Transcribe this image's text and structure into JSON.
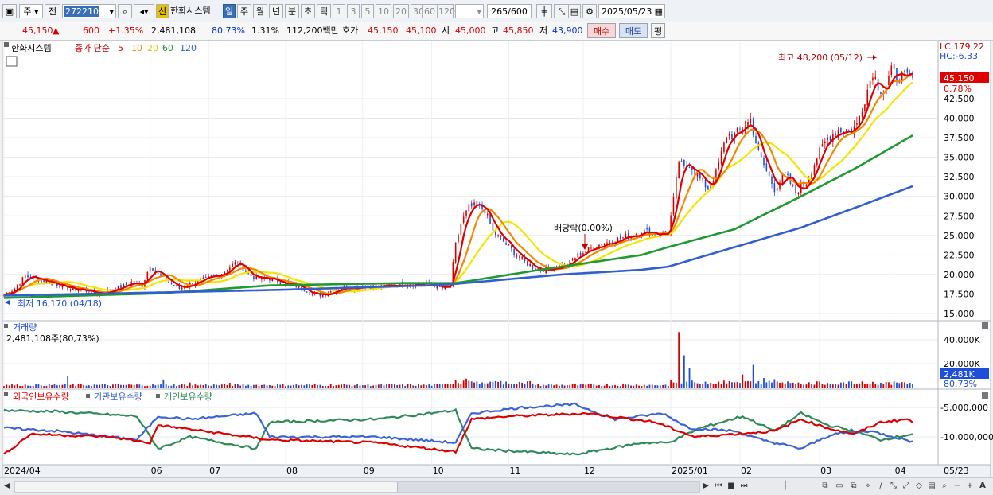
{
  "toolbar": {
    "market": "주",
    "prev_label": "전",
    "code": "272210",
    "new_badge": "신",
    "stock_name": "한화시스템",
    "periods": [
      "일",
      "주",
      "월",
      "년",
      "분",
      "초",
      "틱"
    ],
    "active_period": "일",
    "intervals": [
      "1",
      "3",
      "5",
      "10",
      "20",
      "30",
      "60",
      "120"
    ],
    "count": "265",
    "count_total": "/600",
    "date": "2025/05/23"
  },
  "info": {
    "price": "45,150",
    "arrow": "▲",
    "change": "600",
    "change_pct": "+1.35%",
    "volume": "2,481,108",
    "vol_ratio": "80.73%",
    "turnover": "1.31%",
    "amount": "112,200백만",
    "quote_label": "호가",
    "ask": "45,150",
    "bid": "45,100",
    "open_label": "시",
    "open": "45,000",
    "high_label": "고",
    "high": "45,850",
    "low_label": "저",
    "low": "43,900",
    "buy_label": "매수",
    "sell_label": "매도",
    "eval_label": "평"
  },
  "colors": {
    "up": "#d40000",
    "down": "#1f4fd8",
    "ma5": "#e00000",
    "ma10": "#f08a00",
    "ma20": "#f5e400",
    "ma60": "#1f9a2e",
    "ma120": "#2f5fd0",
    "foreign": "#e00000",
    "institution": "#3a63d6",
    "individual": "#2e8b57"
  },
  "chart_data": [
    {
      "type": "candlestick",
      "panel": "price",
      "stock": "한화시스템",
      "legend": {
        "title": "한화시스템",
        "series_label": "종가 단순",
        "ma_periods": [
          "5",
          "10",
          "20",
          "60",
          "120"
        ]
      },
      "right_top": {
        "lc": "LC:179.22",
        "hc": "HC:-6.33"
      },
      "y_ticks": [
        "42,500",
        "40,000",
        "37,500",
        "35,000",
        "32,500",
        "30,000",
        "27,500",
        "25,000",
        "22,500",
        "20,000",
        "17,500",
        "15,000"
      ],
      "y_tick_values": [
        42500,
        40000,
        37500,
        35000,
        32500,
        30000,
        27500,
        25000,
        22500,
        20000,
        17500,
        15000
      ],
      "ylim": [
        14000,
        49500
      ],
      "current_price": "45,150",
      "current_price_value": 45150,
      "current_pct": "0.78%",
      "max_label": "최고 48,200 (05/12)",
      "max_value": 48200,
      "min_label": "최저 16,170 (04/18)",
      "min_value": 16170,
      "event_label": "배당락(0.00%)",
      "x_months": [
        "2024/04",
        "06",
        "07",
        "08",
        "09",
        "10",
        "11",
        "12",
        "2025/01",
        "02",
        "03",
        "04",
        "05",
        "05/23"
      ],
      "close_anchors": [
        [
          0,
          17400
        ],
        [
          4,
          18200
        ],
        [
          8,
          19800
        ],
        [
          12,
          19500
        ],
        [
          18,
          19000
        ],
        [
          24,
          18200
        ],
        [
          30,
          18000
        ],
        [
          36,
          17500
        ],
        [
          40,
          18000
        ],
        [
          44,
          18400
        ],
        [
          48,
          19000
        ],
        [
          52,
          18600
        ],
        [
          55,
          21200
        ],
        [
          58,
          20000
        ],
        [
          62,
          19000
        ],
        [
          66,
          18200
        ],
        [
          70,
          18800
        ],
        [
          74,
          19200
        ],
        [
          78,
          19600
        ],
        [
          82,
          20200
        ],
        [
          86,
          21200
        ],
        [
          88,
          21600
        ],
        [
          92,
          20000
        ],
        [
          96,
          19400
        ],
        [
          100,
          19500
        ],
        [
          104,
          19000
        ],
        [
          108,
          18600
        ],
        [
          112,
          18400
        ],
        [
          116,
          17500
        ],
        [
          120,
          17400
        ],
        [
          124,
          18000
        ],
        [
          128,
          18400
        ],
        [
          132,
          18400
        ],
        [
          136,
          18600
        ],
        [
          140,
          18400
        ],
        [
          146,
          18600
        ],
        [
          152,
          18800
        ],
        [
          158,
          18900
        ],
        [
          162,
          18600
        ],
        [
          166,
          18000
        ],
        [
          168,
          18700
        ],
        [
          170,
          23800
        ],
        [
          172,
          26500
        ],
        [
          175,
          28600
        ],
        [
          178,
          28800
        ],
        [
          181,
          28200
        ],
        [
          184,
          25500
        ],
        [
          188,
          24200
        ],
        [
          192,
          22800
        ],
        [
          196,
          21600
        ],
        [
          200,
          20800
        ],
        [
          204,
          20600
        ],
        [
          208,
          21000
        ],
        [
          212,
          21200
        ],
        [
          216,
          22500
        ],
        [
          220,
          23200
        ],
        [
          224,
          23800
        ],
        [
          228,
          24200
        ],
        [
          232,
          24600
        ],
        [
          236,
          25000
        ],
        [
          240,
          25600
        ],
        [
          244,
          25300
        ],
        [
          248,
          25200
        ],
        [
          250,
          25400
        ],
        [
          252,
          29500
        ],
        [
          254,
          34500
        ],
        [
          256,
          33500
        ],
        [
          258,
          34200
        ],
        [
          262,
          32200
        ],
        [
          265,
          31000
        ],
        [
          268,
          33000
        ],
        [
          272,
          37800
        ],
        [
          275,
          37800
        ],
        [
          278,
          38800
        ],
        [
          281,
          39800
        ],
        [
          284,
          35500
        ],
        [
          287,
          33200
        ],
        [
          290,
          31000
        ],
        [
          294,
          32800
        ],
        [
          298,
          30500
        ],
        [
          302,
          31800
        ],
        [
          306,
          35000
        ],
        [
          310,
          37500
        ],
        [
          314,
          38500
        ],
        [
          318,
          38300
        ],
        [
          321,
          39200
        ],
        [
          324,
          42500
        ],
        [
          327,
          46000
        ],
        [
          329,
          44200
        ],
        [
          331,
          43300
        ],
        [
          334,
          46000
        ],
        [
          336,
          45400
        ],
        [
          339,
          45300
        ],
        [
          342,
          45150
        ]
      ],
      "ma_series": {
        "ma60": [
          [
            0,
            17000
          ],
          [
            60,
            17600
          ],
          [
            100,
            18600
          ],
          [
            150,
            18900
          ],
          [
            170,
            18900
          ],
          [
            200,
            20500
          ],
          [
            240,
            22500
          ],
          [
            250,
            23500
          ],
          [
            275,
            25800
          ],
          [
            300,
            30000
          ],
          [
            320,
            33500
          ],
          [
            342,
            37800
          ]
        ],
        "ma120": [
          [
            0,
            17300
          ],
          [
            60,
            17700
          ],
          [
            100,
            18000
          ],
          [
            160,
            18600
          ],
          [
            170,
            18800
          ],
          [
            210,
            20000
          ],
          [
            240,
            20600
          ],
          [
            250,
            21000
          ],
          [
            275,
            23500
          ],
          [
            300,
            26000
          ],
          [
            320,
            28500
          ],
          [
            342,
            31300
          ]
        ]
      }
    },
    {
      "type": "bar",
      "panel": "volume",
      "title": "거래량",
      "current_label": "2,481,108주(80,73%)",
      "y_ticks": [
        "40,000K",
        "20,000K"
      ],
      "y_tick_values": [
        40000,
        20000
      ],
      "current_tag": "2,481K",
      "current_pct": "80.73%",
      "unit": "K shares",
      "spikes": [
        [
          24,
          9500
        ],
        [
          60,
          6800
        ],
        [
          70,
          4200
        ],
        [
          85,
          4000
        ],
        [
          170,
          6500
        ],
        [
          174,
          7500
        ],
        [
          178,
          5200
        ],
        [
          254,
          46500
        ],
        [
          256,
          27000
        ],
        [
          258,
          16000
        ],
        [
          278,
          11000
        ],
        [
          282,
          19000
        ],
        [
          286,
          8000
        ],
        [
          290,
          7000
        ]
      ]
    },
    {
      "type": "line",
      "panel": "ownership",
      "series": [
        {
          "name": "외국인보유수량",
          "color_key": "foreign"
        },
        {
          "name": "기관보유수량",
          "color_key": "institution"
        },
        {
          "name": "개인보유수량",
          "color_key": "individual"
        }
      ],
      "y_ticks": [
        "-5,000,000",
        "-10,000,000"
      ],
      "y_tick_values": [
        -5000000,
        -10000000
      ],
      "ylim": [
        -13500000,
        -2000000
      ]
    }
  ],
  "footer": {
    "scroll_left": "◀",
    "scroll_right": "▶"
  }
}
